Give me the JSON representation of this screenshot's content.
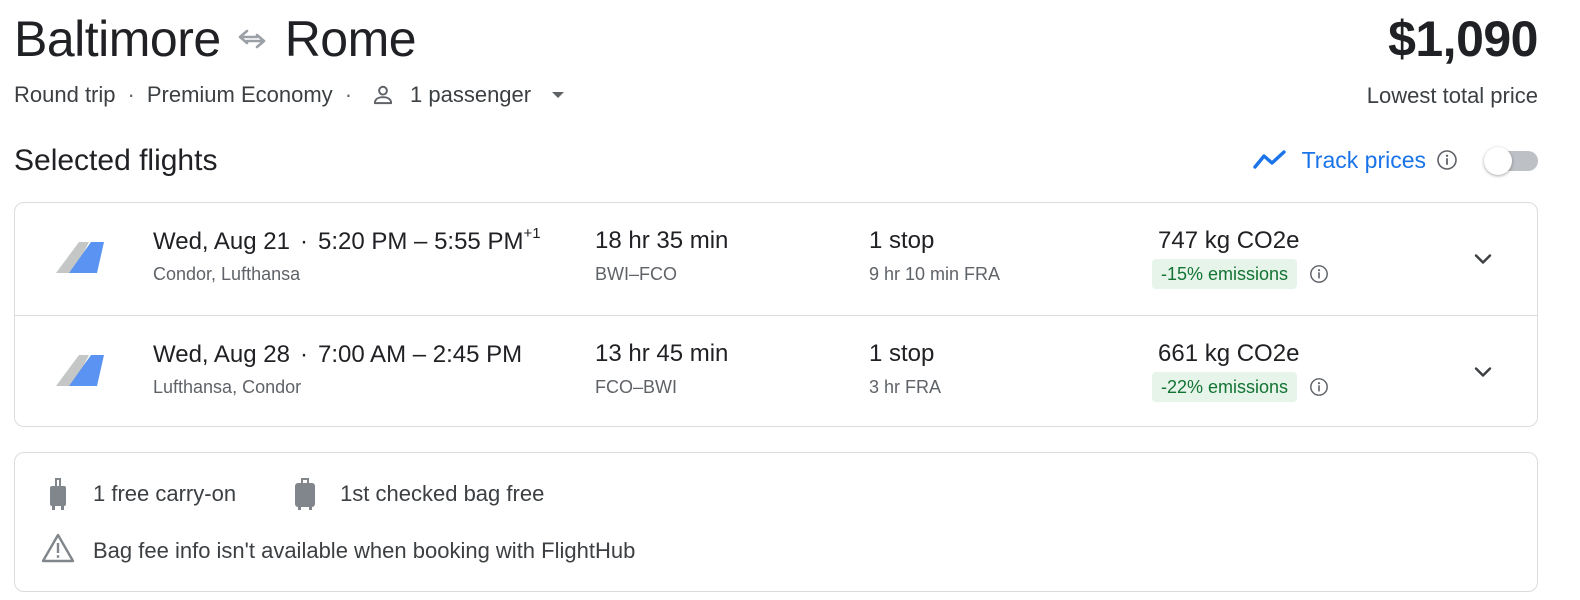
{
  "header": {
    "origin": "Baltimore",
    "destination": "Rome",
    "trip_type": "Round trip",
    "cabin": "Premium Economy",
    "passengers": "1 passenger",
    "price": "$1,090",
    "price_caption": "Lowest total price",
    "swap_icon": "swap-arrows-icon"
  },
  "selected": {
    "title": "Selected flights",
    "track_label": "Track prices",
    "track_enabled": false
  },
  "flights": [
    {
      "date": "Wed, Aug 21",
      "time_range": "5:20 PM – 5:55 PM",
      "day_offset": "+1",
      "airlines": "Condor, Lufthansa",
      "duration": "18 hr 35 min",
      "airports": "BWI–FCO",
      "stops": "1 stop",
      "layover": "9 hr 10 min FRA",
      "co2": "747 kg CO2e",
      "emissions": "-15% emissions"
    },
    {
      "date": "Wed, Aug 28",
      "time_range": "7:00 AM – 2:45 PM",
      "day_offset": "",
      "airlines": "Lufthansa, Condor",
      "duration": "13 hr 45 min",
      "airports": "FCO–BWI",
      "stops": "1 stop",
      "layover": "3 hr FRA",
      "co2": "661 kg CO2e",
      "emissions": "-22% emissions"
    }
  ],
  "bags": {
    "carry_on": "1 free carry-on",
    "checked": "1st checked bag free",
    "warning": "Bag fee info isn't available when booking with FlightHub"
  },
  "colors": {
    "accent": "#1a73e8",
    "emissions_bg": "#e6f4ea",
    "emissions_text": "#137333",
    "border": "#dadce0"
  }
}
